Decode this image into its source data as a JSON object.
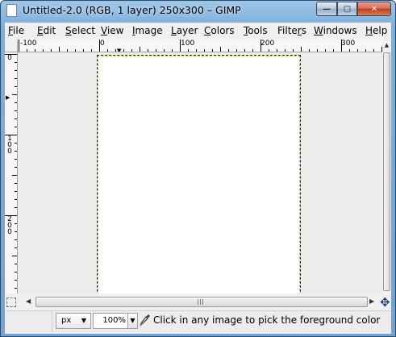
{
  "window": {
    "title": "Untitled-2.0 (RGB, 1 layer) 250x300 – GIMP",
    "controls": {
      "minimize": "—",
      "maximize": "▢",
      "close": "✕"
    }
  },
  "menu": [
    {
      "label": "File",
      "key": "F",
      "rest": "ile"
    },
    {
      "label": "Edit",
      "key": "E",
      "rest": "dit"
    },
    {
      "label": "Select",
      "key": "S",
      "rest": "elect"
    },
    {
      "label": "View",
      "key": "V",
      "rest": "iew"
    },
    {
      "label": "Image",
      "key": "I",
      "rest": "mage"
    },
    {
      "label": "Layer",
      "key": "L",
      "rest": "ayer"
    },
    {
      "label": "Colors",
      "key": "C",
      "rest": "olors"
    },
    {
      "label": "Tools",
      "key": "T",
      "rest": "ools"
    },
    {
      "label": "Filters",
      "key": "r",
      "pre": "Filte",
      "rest": "s"
    },
    {
      "label": "Windows",
      "key": "W",
      "rest": "indows"
    },
    {
      "label": "Help",
      "key": "H",
      "rest": "elp"
    }
  ],
  "rulers": {
    "horizontal_labels": [
      "-100",
      "0",
      "100",
      "200",
      "300"
    ],
    "vertical_labels": [
      "0",
      "100",
      "200"
    ]
  },
  "image": {
    "width": 250,
    "height": 300,
    "mode": "RGB",
    "layers": 1
  },
  "statusbar": {
    "unit": "px",
    "zoom": "100%",
    "message": "Click in any image to pick the foreground color"
  },
  "icons": {
    "quick_mask": "quick-mask-icon",
    "navigate": "navigate-icon",
    "picker": "color-picker-icon"
  },
  "colors": {
    "selection_dash": "#d8c400",
    "canvas_bg": "#ececec",
    "window_frame": "#7eb0dc"
  }
}
